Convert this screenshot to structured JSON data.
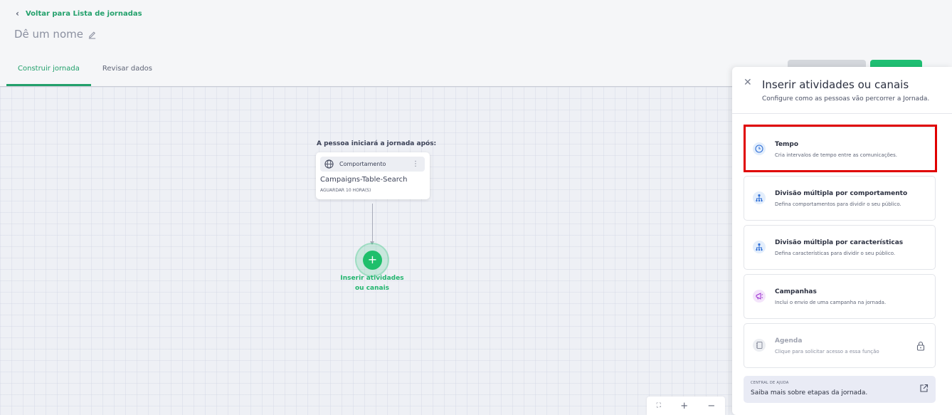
{
  "header": {
    "back_label": "Voltar para Lista de jornadas",
    "journey_name": "Dê um nome",
    "tabs": [
      {
        "label": "Construir jornada",
        "active": true
      },
      {
        "label": "Revisar dados",
        "active": false
      }
    ]
  },
  "canvas": {
    "start_label": "A pessoa iniciará a jornada após:",
    "trigger": {
      "type": "Comportamento",
      "name": "Campaigns-Table-Search",
      "wait": "AGUARDAR 10 HORA(S)"
    },
    "add_node": {
      "label_line1": "Inserir atividades",
      "label_line2": "ou canais"
    },
    "zoom_controls": {
      "fit_icon": "⛶",
      "zoom_in": "+",
      "zoom_out": "−"
    }
  },
  "panel": {
    "title": "Inserir atividades ou canais",
    "subtitle": "Configure como as pessoas vão percorrer a Jornada.",
    "options": [
      {
        "title": "Tempo",
        "description": "Cria intervalos de tempo entre as comunicações.",
        "icon": "clock-icon",
        "highlighted": true
      },
      {
        "title": "Divisão múltipla por comportamento",
        "description": "Defina comportamentos para dividir o seu público.",
        "icon": "split-icon"
      },
      {
        "title": "Divisão múltipla por características",
        "description": "Defina características para dividir o seu público.",
        "icon": "split-icon"
      },
      {
        "title": "Campanhas",
        "description": "Inclui o envio de uma campanha na jornada.",
        "icon": "megaphone-icon"
      },
      {
        "title": "Agenda",
        "description": "Clique para solicitar acesso a essa função",
        "icon": "agenda-icon",
        "locked": true
      }
    ],
    "help": {
      "kicker": "CENTRAL DE AJUDA",
      "text": "Saiba mais sobre etapas da jornada."
    }
  },
  "colors": {
    "accent_green": "#22a06b",
    "highlight_red": "#e00000",
    "panel_bg": "#ffffff",
    "canvas_bg": "#eef0f5"
  }
}
